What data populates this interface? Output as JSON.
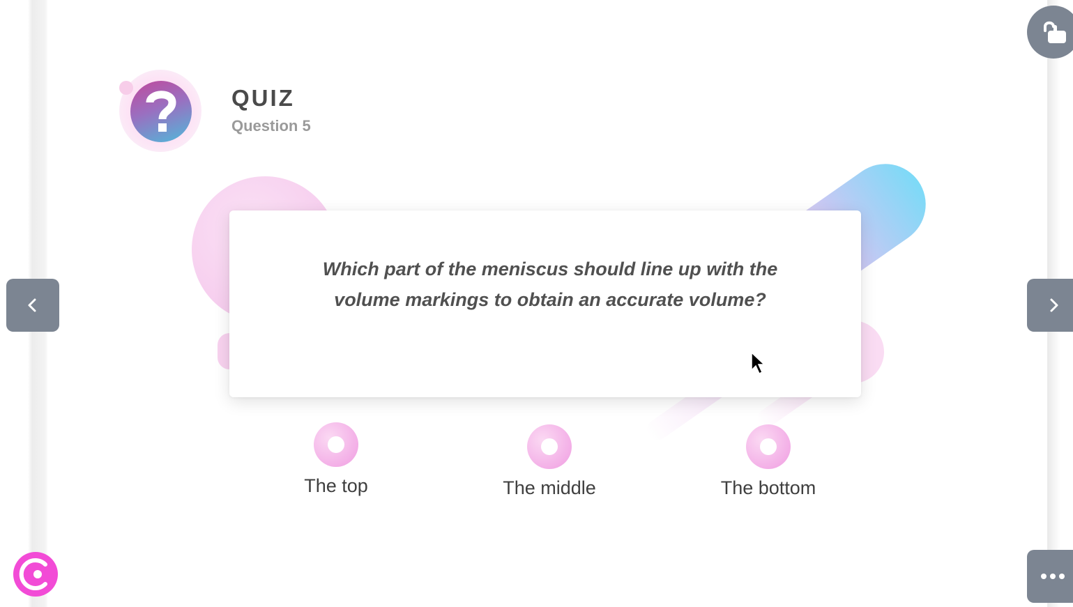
{
  "header": {
    "title": "QUIZ",
    "subtitle": "Question 5"
  },
  "question": {
    "text": "Which part of the meniscus should line up with the volume markings to obtain an accurate volume?"
  },
  "answers": [
    {
      "label": "The top"
    },
    {
      "label": "The middle"
    },
    {
      "label": "The bottom"
    }
  ],
  "colors": {
    "accent": "#f24bd6",
    "button_gray": "#7c8592",
    "radio_pink": "#f2a9e5",
    "text_dark": "#4a4a4a"
  },
  "icons": {
    "quiz": "question-mark-icon",
    "prev": "chevron-left-icon",
    "next": "chevron-right-icon",
    "lock": "unlock-pointer-icon",
    "more": "more-horizontal-icon",
    "brand": "brand-logo-icon"
  }
}
